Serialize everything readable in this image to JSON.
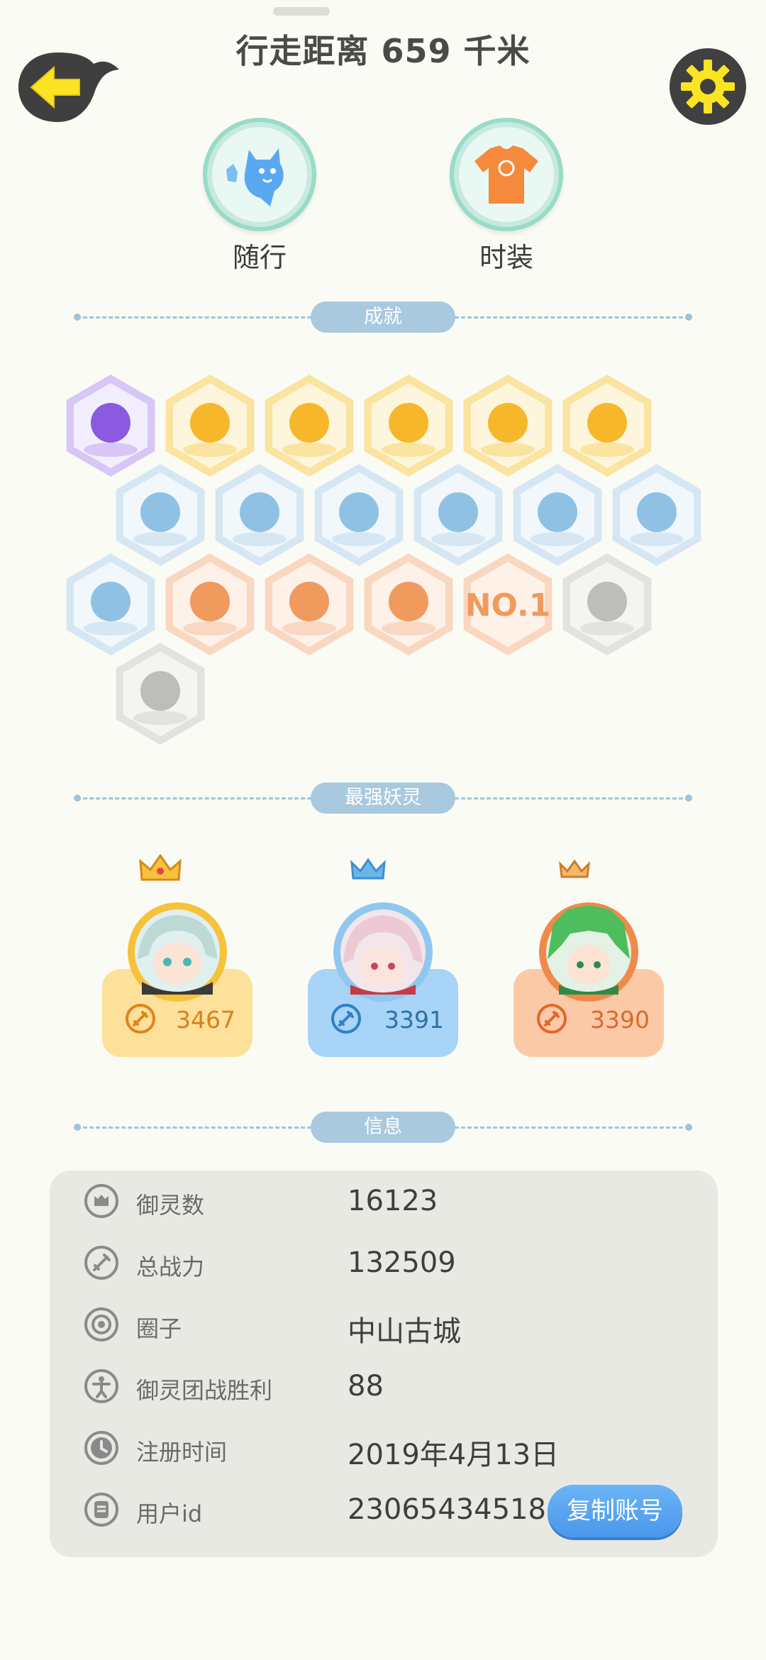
{
  "header": {
    "title": "行走距离 659 千米"
  },
  "top_buttons": [
    {
      "label": "随行",
      "icon": "companion-spirit-icon"
    },
    {
      "label": "时装",
      "icon": "tshirt-icon"
    }
  ],
  "sections": {
    "achievements": "成就",
    "strongest": "最强妖灵",
    "info": "信息"
  },
  "achievements": [
    {
      "icon": "purple-demon-badge",
      "tone": "purple"
    },
    {
      "icon": "sun-badge",
      "tone": "gold"
    },
    {
      "icon": "moon-sun-badge",
      "tone": "gold"
    },
    {
      "icon": "orb-badge",
      "tone": "gold"
    },
    {
      "icon": "yin-yang-swirl-badge",
      "tone": "gold"
    },
    {
      "icon": "scroll-yin-yang-badge",
      "tone": "gold"
    },
    {
      "icon": "shoe-badge",
      "tone": "blue"
    },
    {
      "icon": "crystal-badge",
      "tone": "blue"
    },
    {
      "icon": "spirit-statue-badge",
      "tone": "blue"
    },
    {
      "icon": "dragon-badge",
      "tone": "blue"
    },
    {
      "icon": "shield-badge",
      "tone": "blue"
    },
    {
      "icon": "creature-badge",
      "tone": "blue"
    },
    {
      "icon": "book-fox-badge",
      "tone": "blue"
    },
    {
      "icon": "cart-cat-badge",
      "tone": "orange"
    },
    {
      "icon": "fox-lollipop-badge",
      "tone": "orange"
    },
    {
      "icon": "horned-beast-badge",
      "tone": "orange"
    },
    {
      "icon": "no1-badge",
      "tone": "orange",
      "text": "NO.1"
    },
    {
      "icon": "locked-helmet-badge",
      "tone": "gray"
    },
    {
      "icon": "crossed-swords-badge",
      "tone": "gray"
    }
  ],
  "top_spirits": [
    {
      "value": "3467",
      "theme": "gold",
      "icon": "gold-crown-icon"
    },
    {
      "value": "3391",
      "theme": "blue",
      "icon": "blue-crown-icon"
    },
    {
      "value": "3390",
      "theme": "orange",
      "icon": "orange-crown-icon"
    }
  ],
  "info": [
    {
      "label": "御灵数",
      "value": "16123",
      "icon": "spirit-count-icon"
    },
    {
      "label": "总战力",
      "value": "132509",
      "icon": "sword-icon"
    },
    {
      "label": "圈子",
      "value": "中山古城",
      "icon": "circle-target-icon"
    },
    {
      "label": "御灵团战胜利",
      "value": "88",
      "icon": "trophy-figure-icon"
    },
    {
      "label": "注册时间",
      "value": "2019年4月13日",
      "icon": "clock-icon"
    },
    {
      "label": "用户id",
      "value": "23065434518",
      "icon": "id-card-icon"
    }
  ],
  "copy_button": "复制账号",
  "colors": {
    "accent_blue": "#4a97ec",
    "gold": "#f7c23b",
    "section_pill": "#a9c9de"
  }
}
